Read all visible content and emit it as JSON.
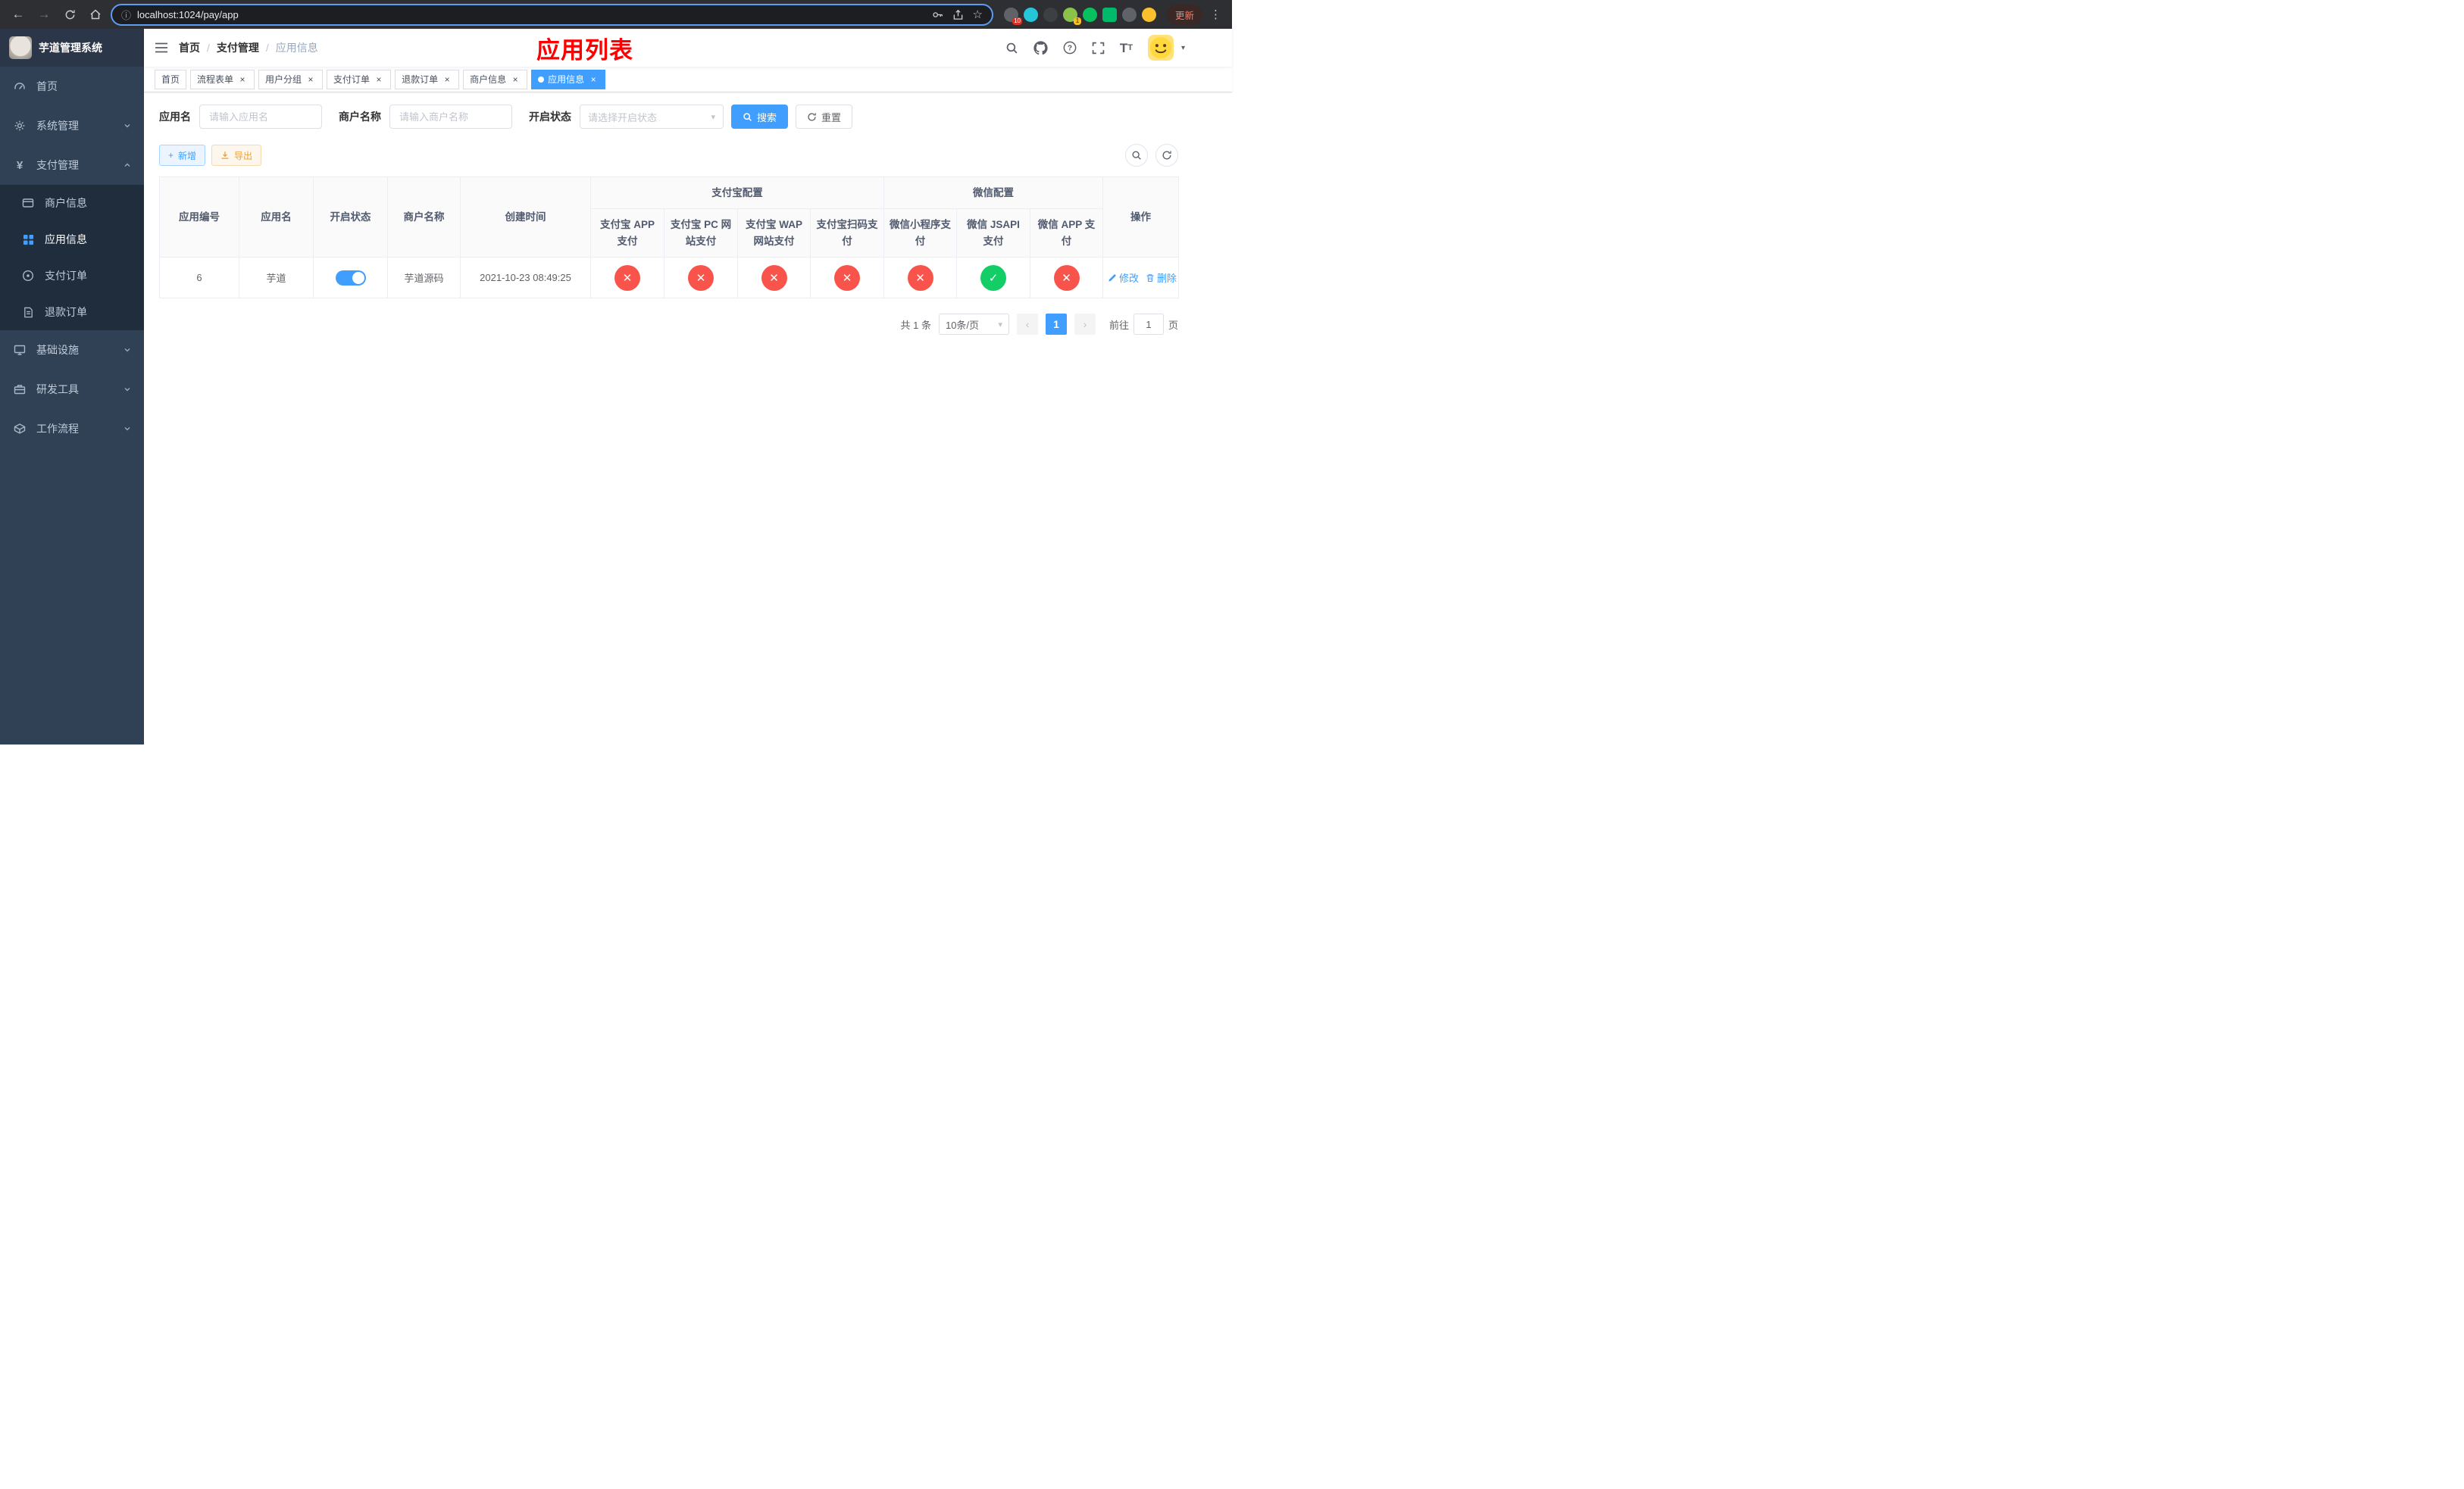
{
  "colors": {
    "primary": "#409eff",
    "success": "#13ce66",
    "danger": "#f9544b",
    "warning": "#e6a23c",
    "overlay_title": "#ff0000"
  },
  "browser": {
    "url": "localhost:1024/pay/app",
    "update_label": "更新",
    "ext_badge_puzzle": "10",
    "ext_badge_green": "1"
  },
  "sidebar": {
    "title": "芋道管理系统",
    "items": [
      {
        "label": "首页"
      },
      {
        "label": "系统管理"
      },
      {
        "label": "支付管理",
        "children": [
          {
            "label": "商户信息"
          },
          {
            "label": "应用信息"
          },
          {
            "label": "支付订单"
          },
          {
            "label": "退款订单"
          }
        ]
      },
      {
        "label": "基础设施"
      },
      {
        "label": "研发工具"
      },
      {
        "label": "工作流程"
      }
    ]
  },
  "header": {
    "breadcrumb": [
      "首页",
      "支付管理",
      "应用信息"
    ],
    "overlay_title": "应用列表"
  },
  "tabs": [
    {
      "label": "首页",
      "closable": false,
      "active": false
    },
    {
      "label": "流程表单",
      "closable": true,
      "active": false
    },
    {
      "label": "用户分组",
      "closable": true,
      "active": false
    },
    {
      "label": "支付订单",
      "closable": true,
      "active": false
    },
    {
      "label": "退款订单",
      "closable": true,
      "active": false
    },
    {
      "label": "商户信息",
      "closable": true,
      "active": false
    },
    {
      "label": "应用信息",
      "closable": true,
      "active": true
    }
  ],
  "filters": {
    "app_name_label": "应用名",
    "app_name_placeholder": "请输入应用名",
    "merchant_name_label": "商户名称",
    "merchant_name_placeholder": "请输入商户名称",
    "status_label": "开启状态",
    "status_placeholder": "请选择开启状态",
    "search_label": "搜索",
    "reset_label": "重置"
  },
  "toolbar": {
    "add_label": "新增",
    "export_label": "导出"
  },
  "table": {
    "groups": {
      "alipay": "支付宝配置",
      "wechat": "微信配置"
    },
    "main_columns": [
      "应用编号",
      "应用名",
      "开启状态",
      "商户名称",
      "创建时间",
      "操作"
    ],
    "sub_columns": [
      "支付宝 APP 支付",
      "支付宝 PC 网站支付",
      "支付宝 WAP 网站支付",
      "支付宝扫码支付",
      "微信小程序支付",
      "微信 JSAPI 支付",
      "微信 APP 支付"
    ],
    "rows": [
      {
        "id": "6",
        "name": "芋道",
        "enabled": true,
        "merchant": "芋道源码",
        "create_time": "2021-10-23 08:49:25",
        "statuses": [
          false,
          false,
          false,
          false,
          false,
          true,
          false
        ],
        "actions": {
          "edit": "修改",
          "delete": "删除"
        }
      }
    ]
  },
  "pagination": {
    "total": "共 1 条",
    "page_size": "10条/页",
    "page": "1",
    "goto": "前往",
    "goto_value": "1",
    "unit": "页"
  }
}
